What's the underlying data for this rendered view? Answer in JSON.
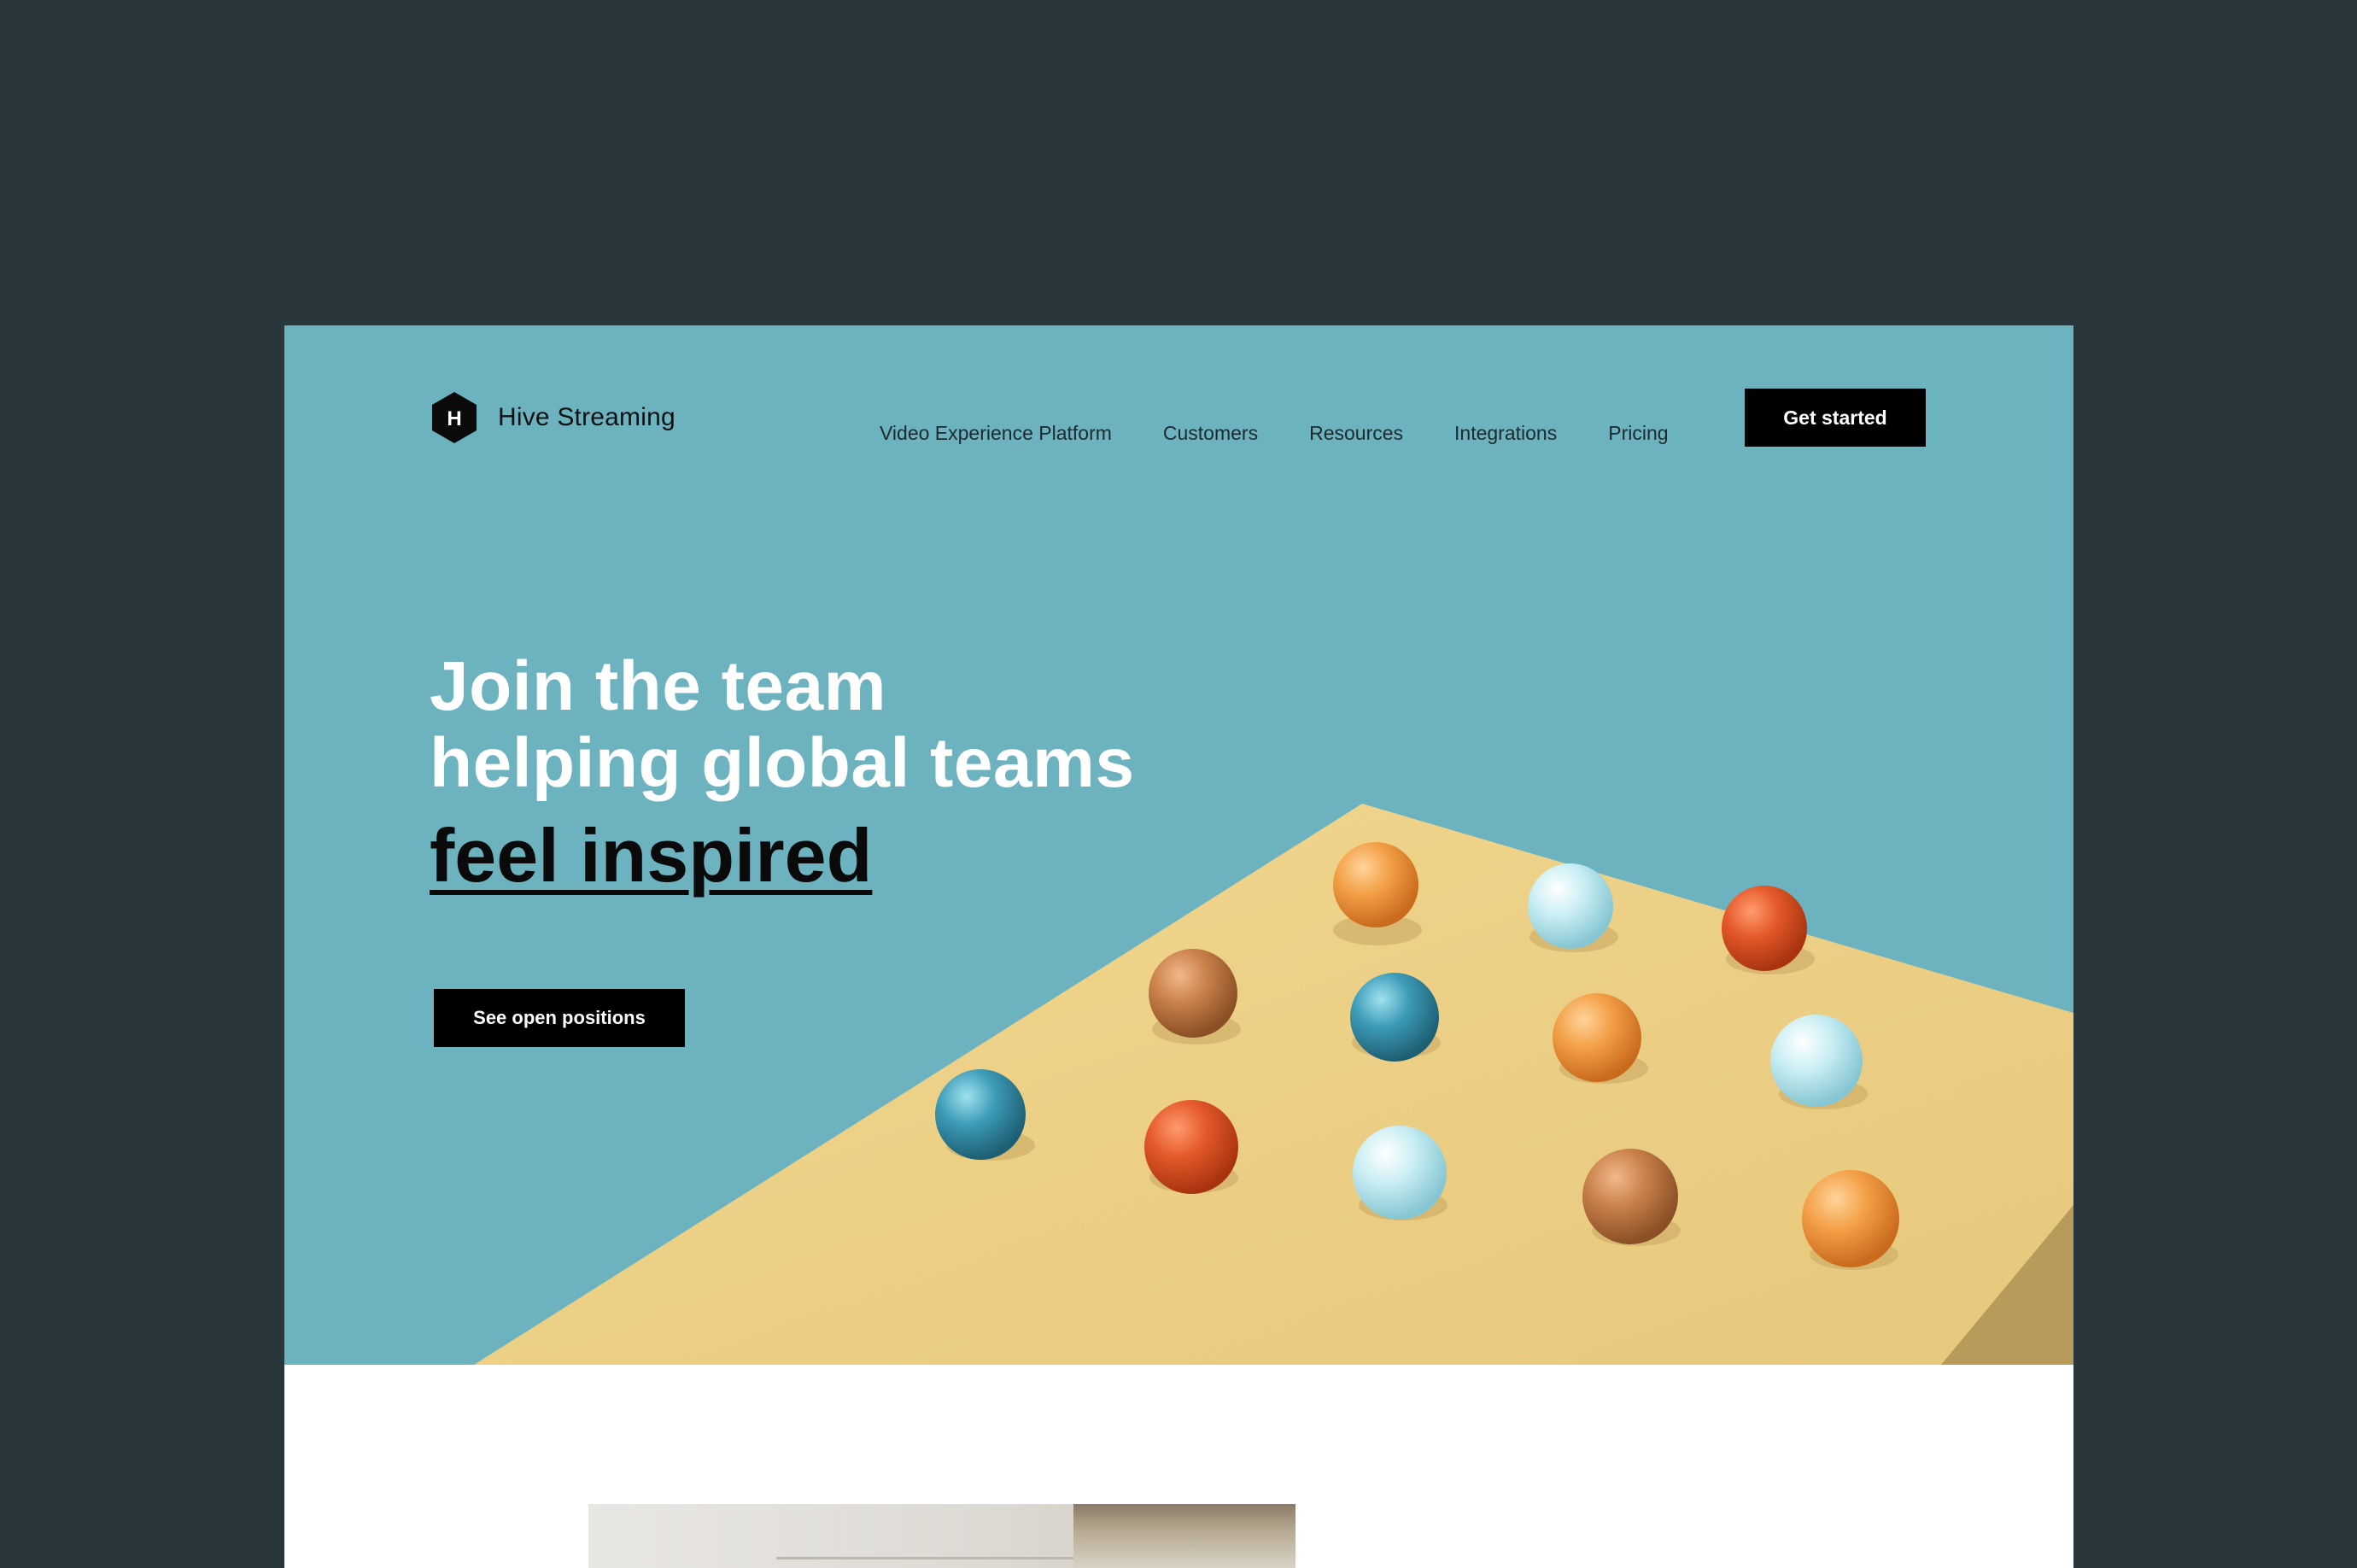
{
  "brand": {
    "name": "Hive Streaming",
    "logo_letter": "H"
  },
  "nav": {
    "items": [
      {
        "label": "Video Experience Platform"
      },
      {
        "label": "Customers"
      },
      {
        "label": "Resources"
      },
      {
        "label": "Integrations"
      },
      {
        "label": "Pricing"
      }
    ],
    "cta_label": "Get started"
  },
  "hero": {
    "headline_line1": "Join the team",
    "headline_line2": "helping global teams",
    "headline_accent": "feel inspired",
    "button_label": "See open positions"
  },
  "colors": {
    "backdrop": "#29373c",
    "hero_background": "#6cb2bf",
    "table_surface": "#ecd28c",
    "button": "#000000",
    "headline": "#ffffff"
  },
  "icons": {
    "logo": "hexagon-h-icon"
  }
}
